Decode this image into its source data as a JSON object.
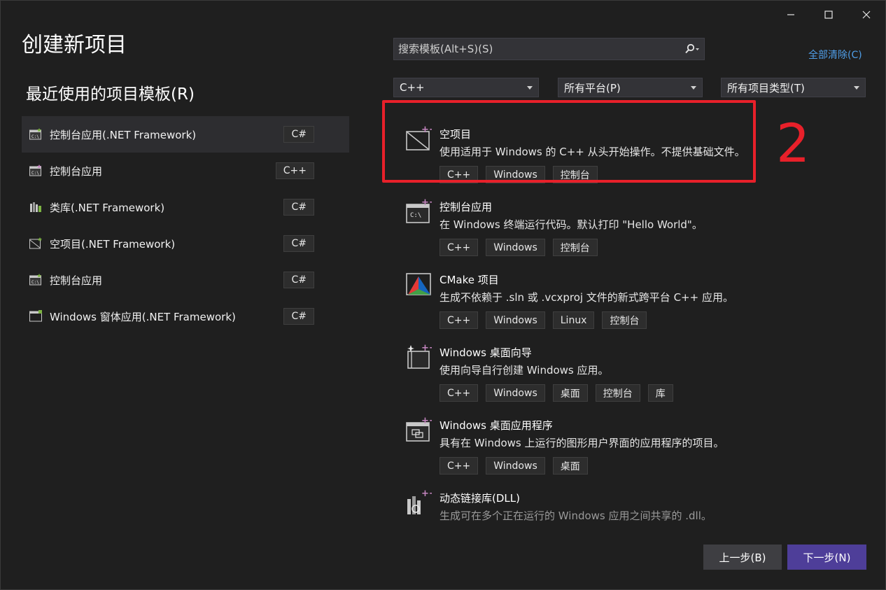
{
  "dialog": {
    "title": "创建新项目",
    "recent_heading": "最近使用的项目模板(R)"
  },
  "recent_templates": [
    {
      "label": "控制台应用(.NET Framework)",
      "lang": "C#",
      "icon": "console-app-icon",
      "selected": true
    },
    {
      "label": "控制台应用",
      "lang": "C++",
      "icon": "console-app-icon"
    },
    {
      "label": "类库(.NET Framework)",
      "lang": "C#",
      "icon": "class-library-icon"
    },
    {
      "label": "空项目(.NET Framework)",
      "lang": "C#",
      "icon": "empty-project-icon"
    },
    {
      "label": "控制台应用",
      "lang": "C#",
      "icon": "console-app-icon"
    },
    {
      "label": "Windows 窗体应用(.NET Framework)",
      "lang": "C#",
      "icon": "windows-forms-icon"
    }
  ],
  "search": {
    "placeholder": "搜索模板(Alt+S)(S)",
    "icon": "search-icon"
  },
  "clear_all_label": "全部清除(C)",
  "filters": {
    "language": "C++",
    "platform": "所有平台(P)",
    "project_type": "所有项目类型(T)"
  },
  "templates": [
    {
      "name": "空项目",
      "description": "使用适用于 Windows 的 C++ 从头开始操作。不提供基础文件。",
      "tags": [
        "C++",
        "Windows",
        "控制台"
      ],
      "icon": "empty-project-icon"
    },
    {
      "name": "控制台应用",
      "description": "在 Windows 终端运行代码。默认打印 \"Hello World\"。",
      "tags": [
        "C++",
        "Windows",
        "控制台"
      ],
      "icon": "console-app-icon"
    },
    {
      "name": "CMake 项目",
      "description": "生成不依赖于 .sln 或 .vcxproj 文件的新式跨平台 C++ 应用。",
      "tags": [
        "C++",
        "Windows",
        "Linux",
        "控制台"
      ],
      "icon": "cmake-icon"
    },
    {
      "name": "Windows 桌面向导",
      "description": "使用向导自行创建 Windows 应用。",
      "tags": [
        "C++",
        "Windows",
        "桌面",
        "控制台",
        "库"
      ],
      "icon": "wizard-icon"
    },
    {
      "name": "Windows 桌面应用程序",
      "description": "具有在 Windows 上运行的图形用户界面的应用程序的项目。",
      "tags": [
        "C++",
        "Windows",
        "桌面"
      ],
      "icon": "desktop-app-icon"
    },
    {
      "name": "动态链接库(DLL)",
      "description": "生成可在多个正在运行的 Windows 应用之间共享的 .dll。",
      "tags": [],
      "icon": "dll-icon"
    }
  ],
  "annotation": {
    "step_number": "2",
    "color": "#e8202a"
  },
  "buttons": {
    "back": "上一步(B)",
    "next": "下一步(N)"
  },
  "colors": {
    "background": "#1f1f1f",
    "accent": "#4e3e99",
    "link": "#4f9ee8"
  }
}
